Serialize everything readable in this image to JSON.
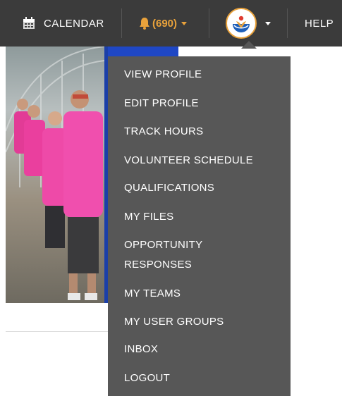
{
  "nav": {
    "calendar_label": "CALENDAR",
    "alerts_label": "(690)",
    "help_label": "HELP"
  },
  "menu": {
    "items": [
      {
        "label": "VIEW PROFILE"
      },
      {
        "label": "EDIT PROFILE"
      },
      {
        "label": "TRACK HOURS"
      },
      {
        "label": "VOLUNTEER SCHEDULE"
      },
      {
        "label": "QUALIFICATIONS"
      },
      {
        "label": "MY FILES"
      },
      {
        "label": "OPPORTUNITY"
      },
      {
        "label": "RESPONSES"
      },
      {
        "label": "MY TEAMS"
      },
      {
        "label": "MY USER GROUPS"
      },
      {
        "label": "INBOX"
      },
      {
        "label": "LOGOUT"
      }
    ]
  },
  "colors": {
    "topbar": "#3b3b3b",
    "menu": "#575757",
    "accent": "#e9a23b",
    "text": "#ffffff"
  },
  "icons": {
    "calendar": "calendar-icon",
    "alerts": "bell-icon",
    "avatar": "united-way-logo-icon"
  }
}
